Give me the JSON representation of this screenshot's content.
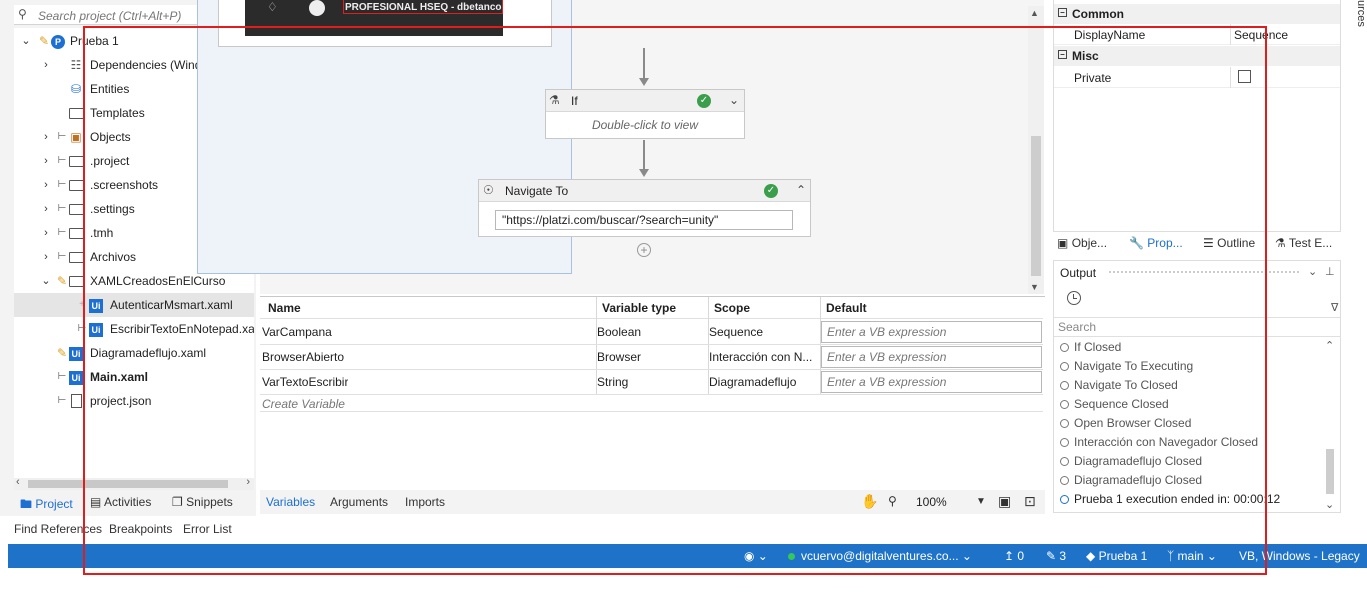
{
  "project_panel": {
    "search_placeholder": "Search project (Ctrl+Alt+P)",
    "tree": [
      {
        "label": "Prueba 1",
        "icon": "project-icon",
        "chevron": "down"
      },
      {
        "label": "Dependencies (Windows - Legacy)",
        "icon": "dependencies-icon",
        "chevron": "right"
      },
      {
        "label": "Entities",
        "icon": "entities-icon",
        "chevron": ""
      },
      {
        "label": "Templates",
        "icon": "folder-icon",
        "chevron": ""
      },
      {
        "label": "Objects",
        "icon": "objects-icon",
        "chevron": "right"
      },
      {
        "label": ".project",
        "icon": "folder-icon",
        "chevron": "right"
      },
      {
        "label": ".screenshots",
        "icon": "folder-icon",
        "chevron": "right"
      },
      {
        "label": ".settings",
        "icon": "folder-icon",
        "chevron": "right"
      },
      {
        "label": ".tmh",
        "icon": "folder-icon",
        "chevron": "right"
      },
      {
        "label": "Archivos",
        "icon": "folder-icon",
        "chevron": "right"
      },
      {
        "label": "XAMLCreadosEnElCurso",
        "icon": "folder-icon",
        "chevron": "down"
      },
      {
        "label": "AutenticarMsmart.xaml",
        "icon": "xaml-icon",
        "chevron": ""
      },
      {
        "label": "EscribirTextoEnNotepad.xaml",
        "icon": "xaml-icon",
        "chevron": ""
      },
      {
        "label": "Diagramadeflujo.xaml",
        "icon": "xaml-icon",
        "chevron": ""
      },
      {
        "label": "Main.xaml",
        "icon": "xaml-icon",
        "chevron": ""
      },
      {
        "label": "project.json",
        "icon": "file-icon",
        "chevron": ""
      }
    ],
    "tabs": [
      "Project",
      "Activities",
      "Snippets"
    ]
  },
  "bottom_tabs": [
    "Find References",
    "Breakpoints",
    "Error List"
  ],
  "designer": {
    "image_caption": "PROFESIONAL HSEQ - dbetanco",
    "if_activity": {
      "title": "If",
      "hint": "Double-click to view"
    },
    "navigate_activity": {
      "title": "Navigate To",
      "url": "\"https://platzi.com/buscar/?search=unity\""
    }
  },
  "variables": {
    "headers": [
      "Name",
      "Variable type",
      "Scope",
      "Default"
    ],
    "rows": [
      {
        "name": "VarCampana",
        "type": "Boolean",
        "scope": "Sequence",
        "default": "Enter a VB expression"
      },
      {
        "name": "BrowserAbierto",
        "type": "Browser",
        "scope": "Interacción con N...",
        "default": "Enter a VB expression"
      },
      {
        "name": "VarTextoEscribir",
        "type": "String",
        "scope": "Diagramadeflujo",
        "default": "Enter a VB expression"
      }
    ],
    "create_label": "Create Variable",
    "tabs": [
      "Variables",
      "Arguments",
      "Imports"
    ],
    "zoom": "100%"
  },
  "properties": {
    "categories": [
      {
        "name": "Common",
        "rows": [
          {
            "key": "DisplayName",
            "value": "Sequence"
          }
        ]
      },
      {
        "name": "Misc",
        "rows": [
          {
            "key": "Private",
            "value": ""
          }
        ]
      }
    ],
    "tabs": [
      "Obje...",
      "Prop...",
      "Outline",
      "Test E..."
    ]
  },
  "output": {
    "title": "Output",
    "search_placeholder": "Search",
    "lines": [
      "If Closed",
      "Navigate To Executing",
      "Navigate To Closed",
      "Sequence Closed",
      "Open Browser Closed",
      "Interacción con Navegador Closed",
      "Diagramadeflujo Closed",
      "Diagramadeflujo Closed",
      "Prueba 1 execution ended in: 00:00:12"
    ]
  },
  "resources_tab": "urces",
  "statusbar": {
    "user": "vcuervo@digitalventures.co...",
    "publish_count": "0",
    "edit_count": "3",
    "project": "Prueba 1",
    "branch": "main",
    "language": "VB, Windows - Legacy"
  },
  "colors": {
    "accent": "#1d6fd1",
    "statusbar": "#1e73c8",
    "success": "#3a9e4c",
    "annotation_red": "#e01c1c"
  }
}
